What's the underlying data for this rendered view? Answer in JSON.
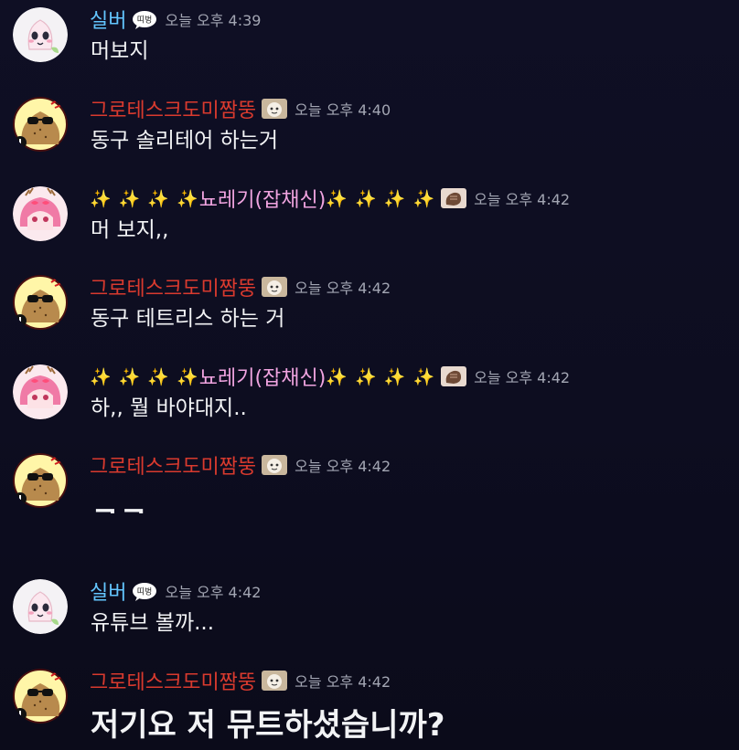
{
  "messages": [
    {
      "author": "실버",
      "time": "오늘 오후 4:39",
      "text": "머보지"
    },
    {
      "author": "그로테스크도미짬뚱",
      "time": "오늘 오후 4:40",
      "text": "동구 솔리테어 하는거"
    },
    {
      "author": "뇨레기(잡채신)",
      "deco_left": "✨ ✨ ✨ ✨",
      "deco_right": "✨ ✨ ✨ ✨",
      "time": "오늘 오후 4:42",
      "text": "머 보지,,"
    },
    {
      "author": "그로테스크도미짬뚱",
      "time": "오늘 오후 4:42",
      "text": "동구 테트리스 하는 거"
    },
    {
      "author": "뇨레기(잡채신)",
      "deco_left": "✨ ✨ ✨ ✨",
      "deco_right": "✨ ✨ ✨ ✨",
      "time": "오늘 오후 4:42",
      "text": "하,, 뭘 바야대지.."
    },
    {
      "author": "그로테스크도미짬뚱",
      "time": "오늘 오후 4:42",
      "text": "ㅋㅋ"
    },
    {
      "author": "실버",
      "time": "오늘 오후 4:42",
      "text": "유튜브 볼까..."
    },
    {
      "author": "그로테스크도미짬뚱",
      "time": "오늘 오후 4:42",
      "text": "저기요 저 뮤트하셨습니까?"
    }
  ],
  "colors": {
    "silver": "#63c6ff",
    "red": "#d93a2e",
    "pink": "#f0a4e0",
    "time": "#a3a6b3"
  },
  "icons": {
    "silver_avatar": "pink-blob-avatar-icon",
    "red_avatar": "potato-sunglasses-avatar-icon",
    "pink_avatar": "pink-hair-deer-girl-avatar-icon",
    "silver_tag": "speech-bubble-tag-icon",
    "red_tag": "face-tag-icon",
    "pink_tag": "hand-tag-icon"
  }
}
